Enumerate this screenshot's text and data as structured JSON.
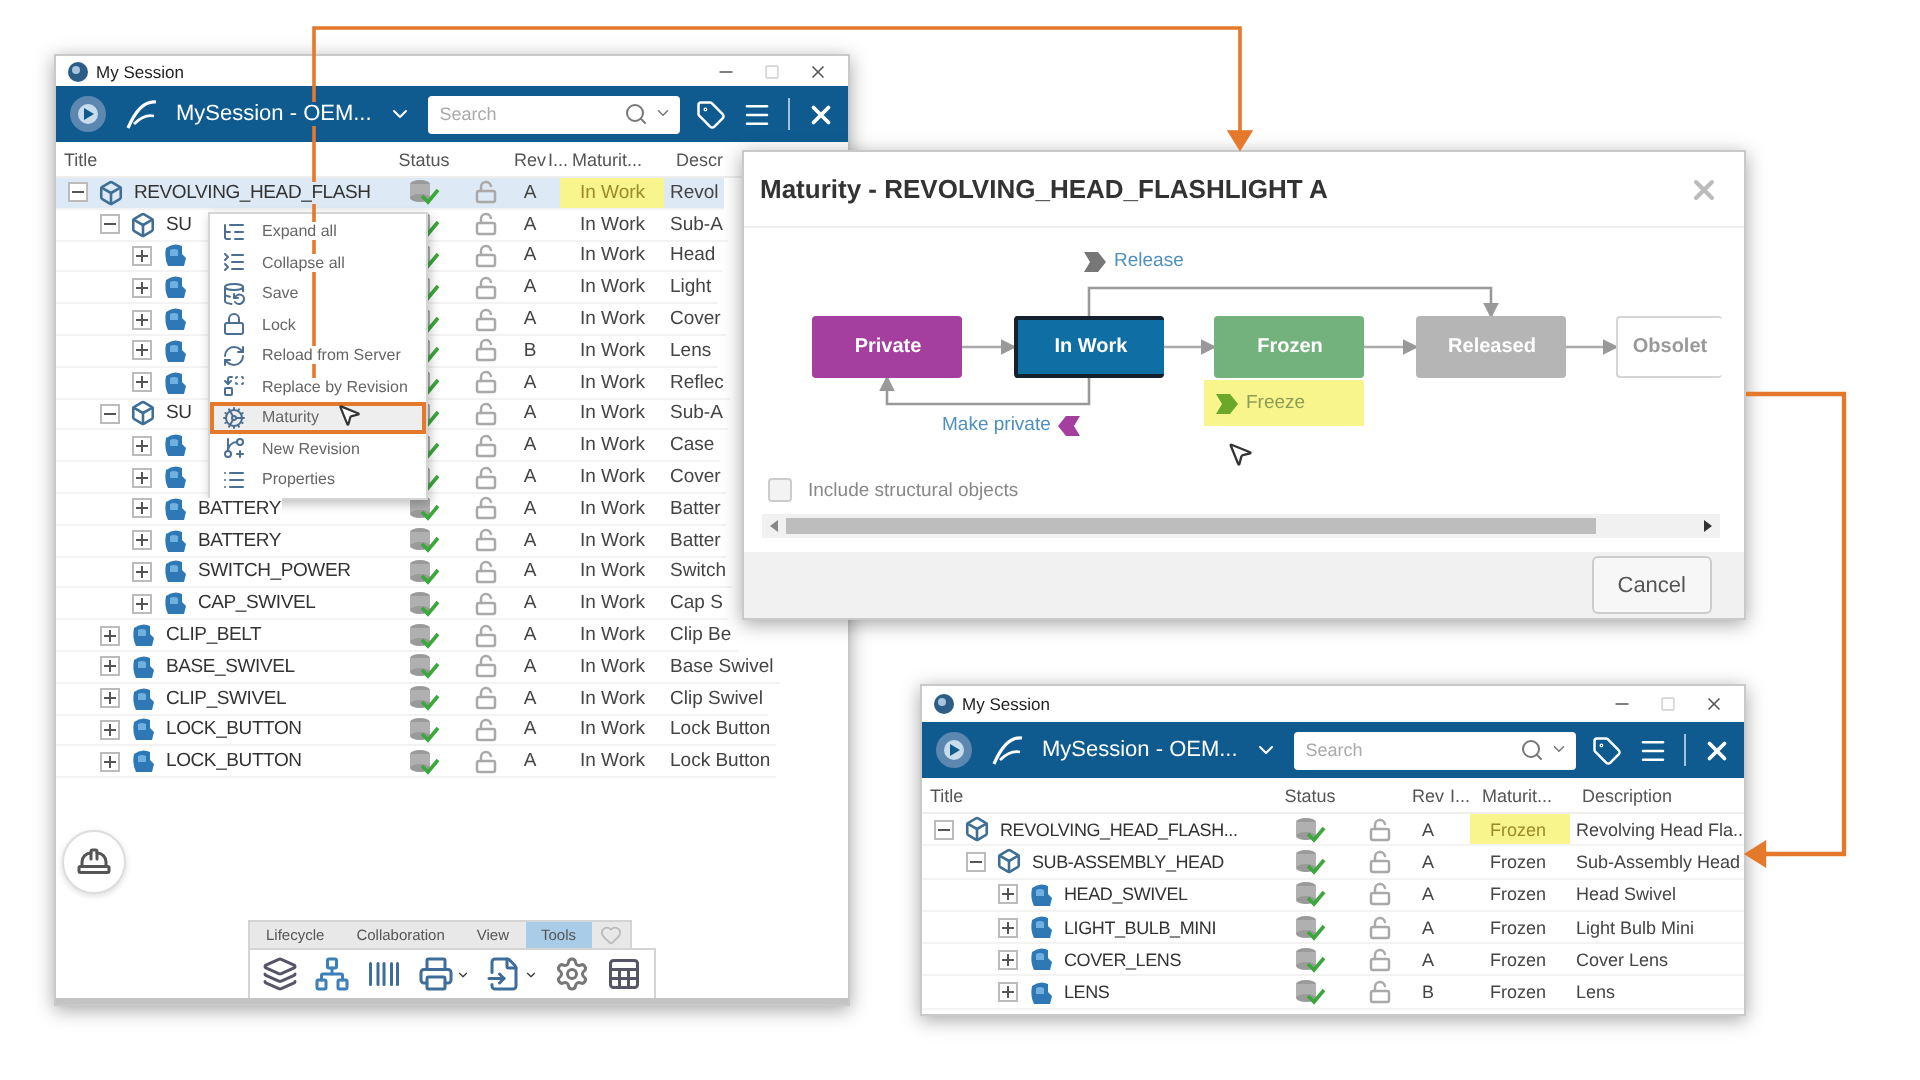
{
  "session_window": {
    "title": "My Session",
    "session": "MySession - OEM...",
    "search": {
      "placeholder": "Search"
    },
    "columns": [
      "Title",
      "Status",
      "Rev",
      "I...",
      "Maturit...",
      "Descr"
    ],
    "rows": [
      {
        "title": "REVOLVING_HEAD_FLASH",
        "kind": "assembly",
        "expanded": true,
        "rev": "A",
        "maturity": "In Work",
        "maturity_highlighted": true,
        "description": "Revol",
        "selected": true,
        "children": [
          {
            "title": "SU",
            "kind": "assembly",
            "expanded": true,
            "rev": "A",
            "maturity": "In Work",
            "maturity_highlighted": false,
            "description": "Sub-A",
            "selected": false,
            "children": [
              {
                "kind": "part",
                "expanded": false,
                "rev": "A",
                "maturity": "In Work",
                "maturity_highlighted": false,
                "description": "Head",
                "selected": false
              },
              {
                "kind": "part",
                "expanded": false,
                "rev": "A",
                "maturity": "In Work",
                "maturity_highlighted": false,
                "description": "Light",
                "selected": false
              },
              {
                "kind": "part",
                "expanded": false,
                "rev": "A",
                "maturity": "In Work",
                "maturity_highlighted": false,
                "description": "Cover",
                "selected": false
              },
              {
                "kind": "part",
                "expanded": false,
                "rev": "B",
                "maturity": "In Work",
                "maturity_highlighted": false,
                "description": "Lens",
                "selected": false
              },
              {
                "kind": "part",
                "expanded": false,
                "rev": "A",
                "maturity": "In Work",
                "maturity_highlighted": false,
                "description": "Reflec",
                "selected": false
              }
            ]
          },
          {
            "title": "SU",
            "kind": "assembly",
            "expanded": true,
            "rev": "A",
            "maturity": "In Work",
            "maturity_highlighted": false,
            "description": "Sub-A",
            "selected": false,
            "children": [
              {
                "kind": "part",
                "expanded": false,
                "rev": "A",
                "maturity": "In Work",
                "maturity_highlighted": false,
                "description": "Case",
                "selected": false
              },
              {
                "kind": "part",
                "expanded": false,
                "rev": "A",
                "maturity": "In Work",
                "maturity_highlighted": false,
                "description": "Cover",
                "selected": false
              },
              {
                "title": "BATTERY",
                "kind": "part",
                "expanded": false,
                "rev": "A",
                "maturity": "In Work",
                "maturity_highlighted": false,
                "description": "Batter",
                "selected": false
              },
              {
                "title": "BATTERY",
                "kind": "part",
                "expanded": false,
                "rev": "A",
                "maturity": "In Work",
                "maturity_highlighted": false,
                "description": "Batter",
                "selected": false
              },
              {
                "title": "SWITCH_POWER",
                "kind": "part",
                "expanded": false,
                "rev": "A",
                "maturity": "In Work",
                "maturity_highlighted": false,
                "description": "Switch",
                "selected": false
              },
              {
                "title": "CAP_SWIVEL",
                "kind": "part",
                "expanded": false,
                "rev": "A",
                "maturity": "In Work",
                "maturity_highlighted": false,
                "description": "Cap S",
                "selected": false
              }
            ]
          },
          {
            "title": "CLIP_BELT",
            "kind": "part",
            "expanded": false,
            "rev": "A",
            "maturity": "In Work",
            "maturity_highlighted": false,
            "description": "Clip Be",
            "selected": false
          },
          {
            "title": "BASE_SWIVEL",
            "kind": "part",
            "expanded": false,
            "rev": "A",
            "maturity": "In Work",
            "maturity_highlighted": false,
            "description": "Base Swivel",
            "selected": false
          },
          {
            "title": "CLIP_SWIVEL",
            "kind": "part",
            "expanded": false,
            "rev": "A",
            "maturity": "In Work",
            "maturity_highlighted": false,
            "description": "Clip Swivel",
            "selected": false
          },
          {
            "title": "LOCK_BUTTON",
            "kind": "part",
            "expanded": false,
            "rev": "A",
            "maturity": "In Work",
            "maturity_highlighted": false,
            "description": "Lock Button",
            "selected": false
          },
          {
            "title": "LOCK_BUTTON",
            "kind": "part",
            "expanded": false,
            "rev": "A",
            "maturity": "In Work",
            "maturity_highlighted": false,
            "description": "Lock Button",
            "selected": false
          }
        ]
      }
    ],
    "context_menu": [
      {
        "label": "Expand all",
        "selected": false
      },
      {
        "label": "Collapse all",
        "selected": false
      },
      {
        "label": "Save",
        "selected": false
      },
      {
        "label": "Lock",
        "selected": false
      },
      {
        "label": "Reload from Server",
        "selected": false
      },
      {
        "label": "Replace by Revision",
        "selected": false
      },
      {
        "label": "Maturity",
        "selected": true
      },
      {
        "label": "New Revision",
        "selected": false
      },
      {
        "label": "Properties",
        "selected": false
      }
    ],
    "toolbar_tabs": [
      {
        "label": "Lifecycle",
        "selected": false
      },
      {
        "label": "Collaboration",
        "selected": false
      },
      {
        "label": "View",
        "selected": false
      },
      {
        "label": "Tools",
        "selected": true
      }
    ]
  },
  "maturity_dialog": {
    "title": "Maturity - REVOLVING_HEAD_FLASHLIGHT A",
    "states": [
      {
        "label": "Private",
        "color": "#a43f9f",
        "current": false
      },
      {
        "label": "In Work",
        "color": "#0f6ea3",
        "current": true
      },
      {
        "label": "Frozen",
        "color": "#74b27d",
        "current": false
      },
      {
        "label": "Released",
        "color": "#b5b5b5",
        "current": false
      },
      {
        "label": "Obsolet",
        "color": "#ffffff",
        "current": false
      }
    ],
    "transitions": [
      {
        "label": "Release",
        "kind": "forward",
        "color": "#777777",
        "highlighted": false
      },
      {
        "label": "Make private",
        "kind": "backward",
        "color": "#a43f9f",
        "highlighted": false
      },
      {
        "label": "Freeze",
        "kind": "forward",
        "color": "#6aa82a",
        "highlighted": true
      }
    ],
    "include_structural": {
      "label": "Include structural objects",
      "checked": false
    },
    "buttons": [
      "Cancel"
    ]
  },
  "result_window": {
    "title": "My Session",
    "session": "MySession - OEM...",
    "search": {
      "placeholder": "Search"
    },
    "columns": [
      "Title",
      "Status",
      "Rev",
      "I...",
      "Maturit...",
      "Description"
    ],
    "rows": [
      {
        "title": "REVOLVING_HEAD_FLASH...",
        "kind": "assembly",
        "expanded": true,
        "rev": "A",
        "maturity": "Frozen",
        "maturity_highlighted": true,
        "description": "Revolving Head Fla...",
        "selected": false,
        "children": [
          {
            "title": "SUB-ASSEMBLY_HEAD",
            "kind": "assembly",
            "expanded": true,
            "rev": "A",
            "maturity": "Frozen",
            "maturity_highlighted": false,
            "description": "Sub-Assembly Head",
            "selected": false,
            "children": [
              {
                "title": "HEAD_SWIVEL",
                "kind": "part",
                "expanded": false,
                "rev": "A",
                "maturity": "Frozen",
                "maturity_highlighted": false,
                "description": "Head Swivel",
                "selected": false
              },
              {
                "title": "LIGHT_BULB_MINI",
                "kind": "part",
                "expanded": false,
                "rev": "A",
                "maturity": "Frozen",
                "maturity_highlighted": false,
                "description": "Light Bulb Mini",
                "selected": false
              },
              {
                "title": "COVER_LENS",
                "kind": "part",
                "expanded": false,
                "rev": "A",
                "maturity": "Frozen",
                "maturity_highlighted": false,
                "description": "Cover Lens",
                "selected": false
              },
              {
                "title": "LENS",
                "kind": "part",
                "expanded": false,
                "rev": "B",
                "maturity": "Frozen",
                "maturity_highlighted": false,
                "description": "Lens",
                "selected": false
              }
            ]
          }
        ]
      }
    ]
  }
}
